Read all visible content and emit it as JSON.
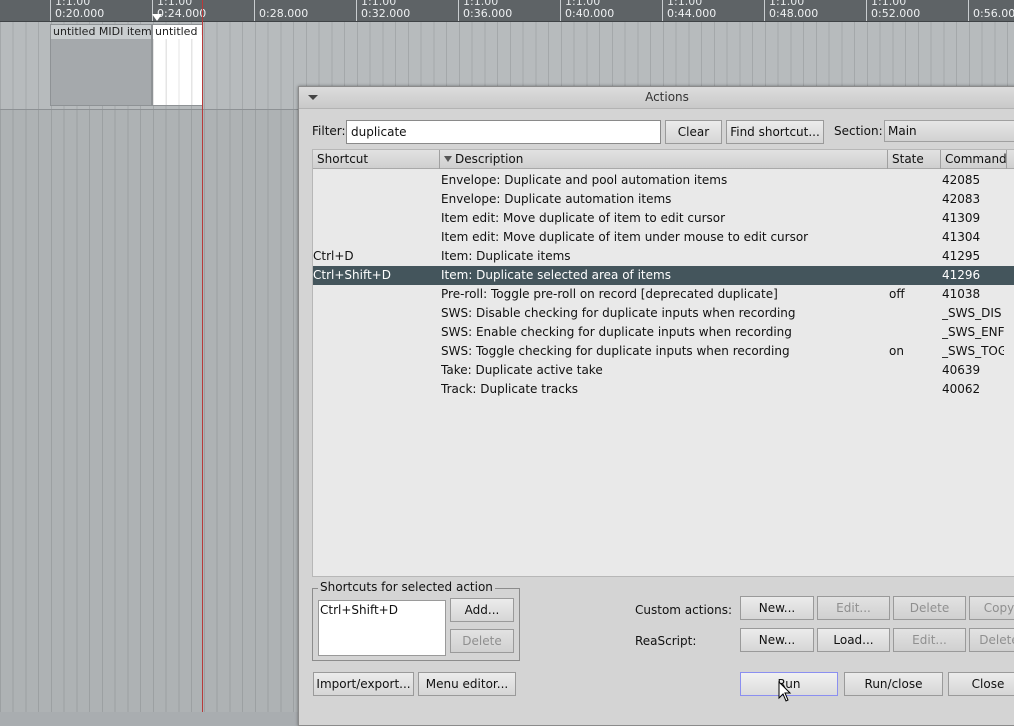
{
  "ruler": {
    "ticks": [
      {
        "top": "1:1.00",
        "time": "0:20.000"
      },
      {
        "top": "1:1.00",
        "time": "0:24.000"
      },
      {
        "top": "",
        "time": "0:28.000"
      },
      {
        "top": "1:1.00",
        "time": "0:32.000"
      },
      {
        "top": "1:1.00",
        "time": "0:36.000"
      },
      {
        "top": "1:1.00",
        "time": "0:40.000"
      },
      {
        "top": "1:1.00",
        "time": "0:44.000"
      },
      {
        "top": "1:1.00",
        "time": "0:48.000"
      },
      {
        "top": "1:1.00",
        "time": "0:52.000"
      },
      {
        "top": "",
        "time": "0:56.00"
      }
    ]
  },
  "items": [
    {
      "name": "untitled MIDI item"
    },
    {
      "name": "untitled MIDI item"
    }
  ],
  "dialog": {
    "title": "Actions",
    "filter_label": "Filter:",
    "filter_value": "duplicate",
    "clear_label": "Clear",
    "find_shortcut_label": "Find shortcut...",
    "section_label": "Section:",
    "section_value": "Main",
    "columns": {
      "shortcut": "Shortcut",
      "description": "Description",
      "state": "State",
      "command": "Command"
    },
    "rows": [
      {
        "shortcut": "",
        "description": "Envelope: Duplicate and pool automation items",
        "state": "",
        "command": "42085"
      },
      {
        "shortcut": "",
        "description": "Envelope: Duplicate automation items",
        "state": "",
        "command": "42083"
      },
      {
        "shortcut": "",
        "description": "Item edit: Move duplicate of item to edit cursor",
        "state": "",
        "command": "41309"
      },
      {
        "shortcut": "",
        "description": "Item edit: Move duplicate of item under mouse to edit cursor",
        "state": "",
        "command": "41304"
      },
      {
        "shortcut": "Ctrl+D",
        "description": "Item: Duplicate items",
        "state": "",
        "command": "41295"
      },
      {
        "shortcut": "Ctrl+Shift+D",
        "description": "Item: Duplicate selected area of items",
        "state": "",
        "command": "41296"
      },
      {
        "shortcut": "",
        "description": "Pre-roll: Toggle pre-roll on record [deprecated duplicate]",
        "state": "off",
        "command": "41038"
      },
      {
        "shortcut": "",
        "description": "SWS: Disable checking for duplicate inputs when recording",
        "state": "",
        "command": "_SWS_DIS"
      },
      {
        "shortcut": "",
        "description": "SWS: Enable checking for duplicate inputs when recording",
        "state": "",
        "command": "_SWS_ENF"
      },
      {
        "shortcut": "",
        "description": "SWS: Toggle checking for duplicate inputs when recording",
        "state": "on",
        "command": "_SWS_TOG"
      },
      {
        "shortcut": "",
        "description": "Take: Duplicate active take",
        "state": "",
        "command": "40639"
      },
      {
        "shortcut": "",
        "description": "Track: Duplicate tracks",
        "state": "",
        "command": "40062"
      }
    ],
    "selected_row_index": 5,
    "shortcuts_group_label": "Shortcuts for selected action",
    "selected_shortcut": "Ctrl+Shift+D",
    "add_label": "Add...",
    "delete_label": "Delete",
    "custom_actions_label": "Custom actions:",
    "reascript_label": "ReaScript:",
    "custom_new_label": "New...",
    "custom_edit_label": "Edit...",
    "custom_delete_label": "Delete",
    "custom_copy_label": "Copy",
    "rs_new_label": "New...",
    "rs_load_label": "Load...",
    "rs_edit_label": "Edit...",
    "rs_delete_label": "Delete",
    "import_export_label": "Import/export...",
    "menu_editor_label": "Menu editor...",
    "run_label": "Run",
    "run_close_label": "Run/close",
    "close_label": "Close"
  }
}
